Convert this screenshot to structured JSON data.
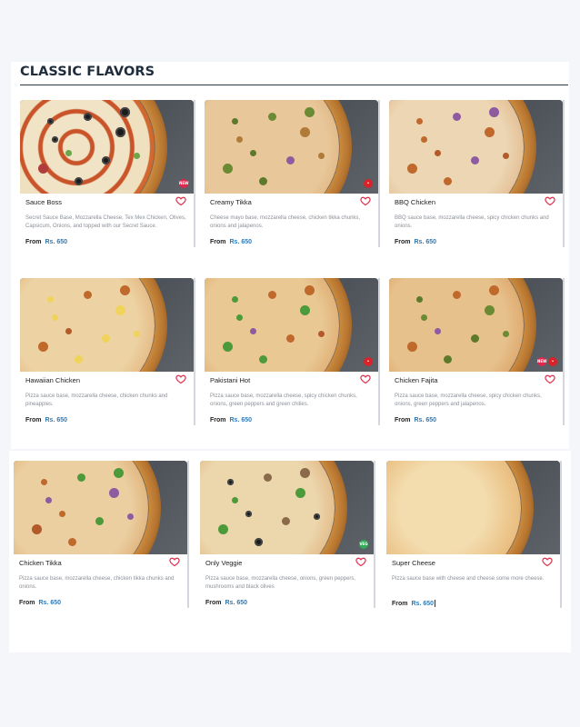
{
  "section": {
    "title": "CLASSIC FLAVORS"
  },
  "colors": {
    "price": "#2f79b5",
    "heart": "#e0304e",
    "new_badge": "#e2264d",
    "spicy_badge": "#d8232a",
    "veg_badge": "#2faa57"
  },
  "products": [
    {
      "name": "Sauce Boss",
      "description": "Secret Sauce Base, Mozzarella Cheese, Tex Mex Chicken, Olives, Capsicum, Onions, and topped with our Secret Sauce.",
      "from_label": "From",
      "price": "Rs. 650",
      "badges": [
        "NEW"
      ],
      "favorite_icon": "heart-outline-icon"
    },
    {
      "name": "Creamy Tikka",
      "description": "Cheese mayo base, mozzarella cheese, chicken tikka chunks, onions and jalapenos.",
      "from_label": "From",
      "price": "Rs. 650",
      "badges": [
        "spicy"
      ],
      "favorite_icon": "heart-outline-icon"
    },
    {
      "name": "BBQ Chicken",
      "description": "BBQ sauce base, mozzarella cheese, spicy chicken chunks and onions.",
      "from_label": "From",
      "price": "Rs. 650",
      "badges": [],
      "favorite_icon": "heart-outline-icon"
    },
    {
      "name": "Hawaiian Chicken",
      "description": "Pizza sauce base, mozzarella cheese, chicken chunks and pineapples.",
      "from_label": "From",
      "price": "Rs. 650",
      "badges": [],
      "favorite_icon": "heart-outline-icon"
    },
    {
      "name": "Pakistani Hot",
      "description": "Pizza sauce base, mozzarella cheese, spicy chicken chunks, onions, green peppers and green chilies.",
      "from_label": "From",
      "price": "Rs. 650",
      "badges": [
        "spicy"
      ],
      "favorite_icon": "heart-outline-icon"
    },
    {
      "name": "Chicken Fajita",
      "description": "Pizza sauce base, mozzarella cheese, spicy chicken chunks, onions, green peppers and jalapenos.",
      "from_label": "From",
      "price": "Rs. 650",
      "badges": [
        "NEW",
        "spicy"
      ],
      "favorite_icon": "heart-outline-icon"
    },
    {
      "name": "Chicken Tikka",
      "description": "Pizza sauce base, mozzarella cheese, chicken tikka chunks and onions.",
      "from_label": "From",
      "price": "Rs. 650",
      "badges": [],
      "favorite_icon": "heart-outline-icon"
    },
    {
      "name": "Only Veggie",
      "description": "Pizza sauce base, mozzarella cheese, onions, green peppers, mushrooms and black olives",
      "from_label": "From",
      "price": "Rs. 650",
      "badges": [
        "VEG"
      ],
      "favorite_icon": "heart-outline-icon"
    },
    {
      "name": "Super Cheese",
      "description": "Pizza sauce base with cheese and cheese some more cheese.",
      "from_label": "From",
      "price": "Rs. 650",
      "badges": [],
      "favorite_icon": "heart-outline-icon"
    }
  ]
}
